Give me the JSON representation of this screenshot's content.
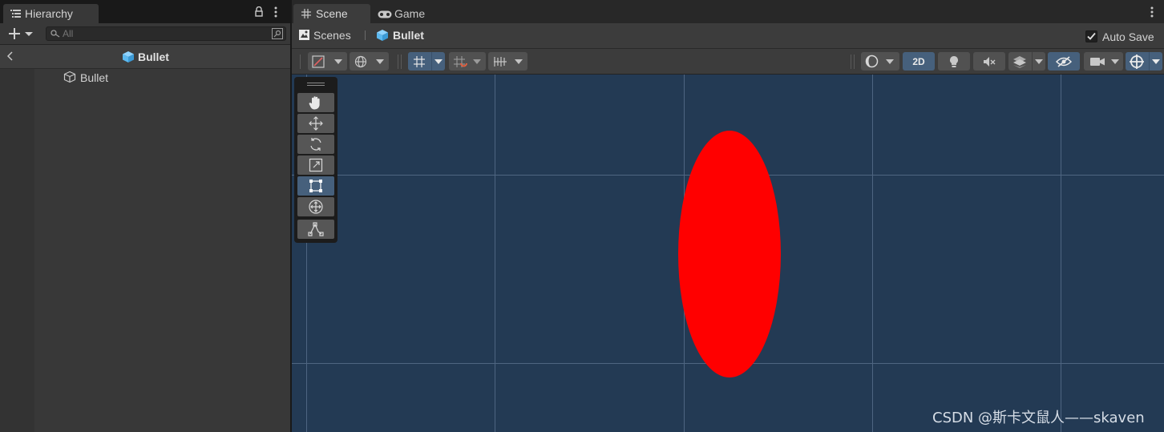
{
  "hierarchy": {
    "tab_label": "Hierarchy",
    "search_placeholder": "All",
    "breadcrumb_label": "Bullet",
    "items": [
      {
        "label": "Bullet"
      }
    ]
  },
  "scene": {
    "tabs": [
      {
        "label": "Scene",
        "active": true
      },
      {
        "label": "Game",
        "active": false
      }
    ],
    "breadcrumb": {
      "scenes_label": "Scenes",
      "prefab_label": "Bullet"
    },
    "auto_save_label": "Auto Save",
    "auto_save_checked": true,
    "mode_2d_label": "2D",
    "tool_palette": [
      "hand-tool",
      "move-tool",
      "rotate-tool",
      "scale-tool",
      "rect-tool",
      "transform-tool",
      "custom-editor-tool"
    ],
    "active_tool": "rect-tool",
    "sprite_color": "#ff0000"
  },
  "colors": {
    "viewport_bg": "#233a54",
    "panel_bg": "#383838",
    "accent_active": "#46607c",
    "prefab_blue": "#5cb9f0"
  },
  "watermark": "CSDN @斯卡文鼠人——skaven"
}
